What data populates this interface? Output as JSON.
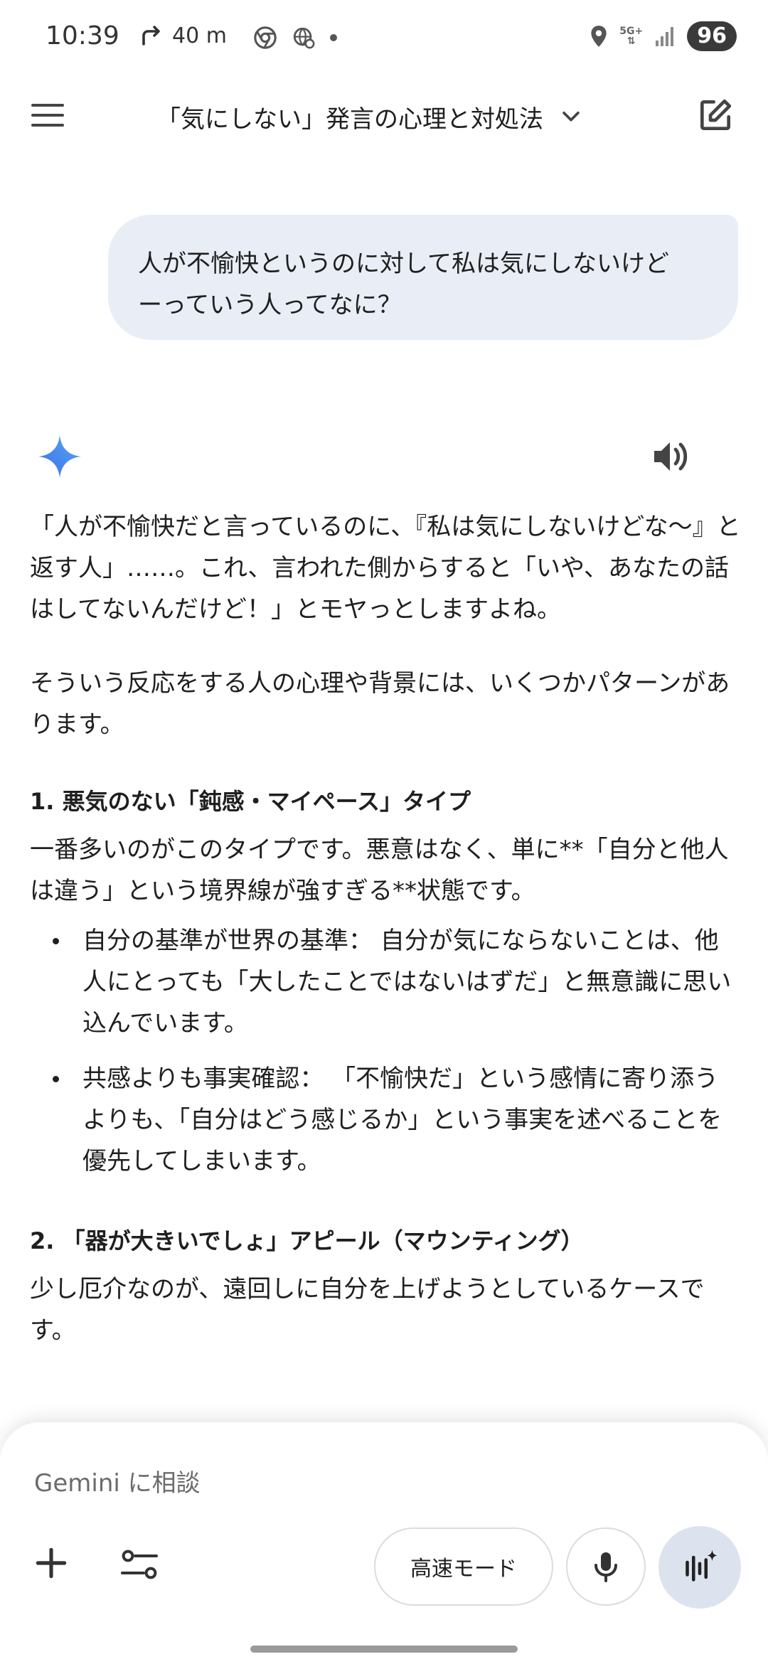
{
  "status_bar": {
    "time": "10:39",
    "nav_distance": "40 m",
    "network": "5G+",
    "battery": "96",
    "icons": [
      "navigation-arrow-icon",
      "chrome-icon",
      "vpn-globe-icon",
      "location-icon",
      "signal-icon"
    ]
  },
  "header": {
    "title": "「気にしない」発言の心理と対処法"
  },
  "user_message": {
    "line1": "人が不愉快というのに対して私は気にしないけど",
    "line2": "ーっていう人ってなに？"
  },
  "response": {
    "para1": "「人が不愉快だと言っているのに、『私は気にしないけどな〜』と返す人」……。これ、言われた側からすると「いや、あなたの話はしてないんだけど！」とモヤっとしますよね。",
    "para2": "そういう反応をする人の心理や背景には、いくつかパターンがあります。",
    "section1": {
      "heading": "1. 悪気のない「鈍感・マイペース」タイプ",
      "text": "一番多いのがこのタイプです。悪意はなく、単に**「自分と他人は違う」という境界線が強すぎる**状態です。",
      "bullets": [
        "自分の基準が世界の基準： 自分が気にならないことは、他人にとっても「大したことではないはずだ」と無意識に思い込んでいます。",
        "共感よりも事実確認： 「不愉快だ」という感情に寄り添うよりも、「自分はどう感じるか」という事実を述べることを優先してしまいます。"
      ]
    },
    "section2": {
      "heading": "2. 「器が大きいでしょ」アピール（マウンティング）",
      "text": "少し厄介なのが、遠回しに自分を上げようとしているケースです。"
    }
  },
  "input": {
    "placeholder": "Gemini に相談",
    "mode_label": "高速モード"
  },
  "colors": {
    "bubble": "#e9eef6",
    "gemini_blue": "#4a8ef0",
    "live_button": "#dde3ee"
  }
}
